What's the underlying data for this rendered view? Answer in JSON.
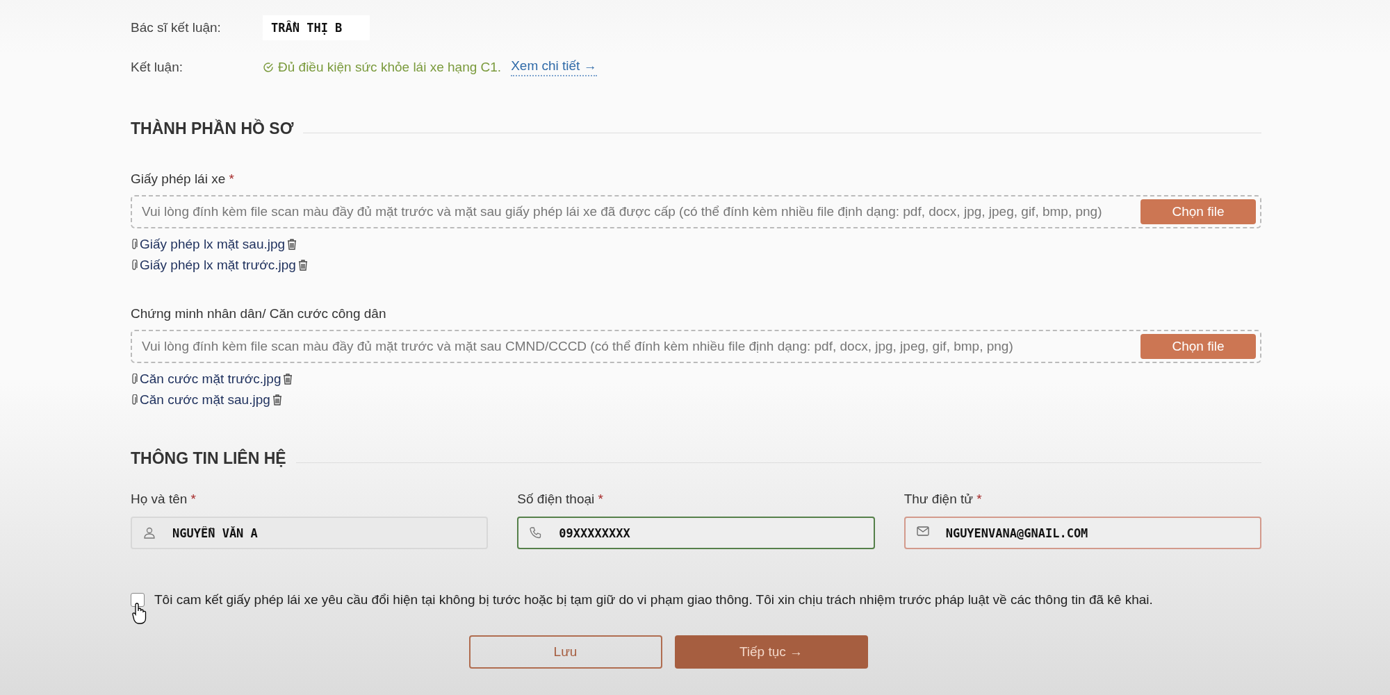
{
  "summary": [
    {
      "kind": "value",
      "label": "Bác sĩ kết luận:",
      "value": "TRẦN THỊ B"
    },
    {
      "kind": "conclusion",
      "label": "Kết luận:",
      "value": "Đủ điều kiện sức khỏe lái xe hạng C1.",
      "link": "Xem chi tiết →"
    }
  ],
  "documents": {
    "title": "THÀNH PHẦN HỒ SƠ",
    "groups": [
      {
        "label": "Giấy phép lái xe",
        "mark": "*",
        "placeholder": "Vui lòng đính kèm file scan màu đầy đủ mặt trước và mặt sau giấy phép lái xe đã được cấp (có thể đính kèm nhiều file định dạng: pdf, docx, jpg, jpeg, gif, bmp, png)",
        "button": "Chọn file",
        "files": [
          "Giấy phép lx mặt sau.jpg",
          "Giấy phép lx mặt trước.jpg"
        ]
      },
      {
        "label": "Chứng minh nhân dân/ Căn cước công dân",
        "placeholder": "Vui lòng đính kèm file scan màu đầy đủ mặt trước và mặt sau CMND/CCCD (có thể đính kèm nhiều file định dạng: pdf, docx, jpg, jpeg, gif, bmp, png)",
        "button": "Chọn file",
        "files": [
          "Căn cước mặt trước.jpg",
          "Căn cước mặt sau.jpg"
        ]
      }
    ]
  },
  "contact": {
    "title": "THÔNG TIN LIÊN HỆ",
    "fields": [
      {
        "kind": "person",
        "label": "Họ và tên",
        "mark": "*",
        "value": "NGUYỄN VĂN A",
        "valid": false,
        "error": false
      },
      {
        "kind": "phone",
        "label": "Số điện thoại",
        "mark": "*",
        "value": "09XXXXXXXX",
        "valid": true,
        "error": false
      },
      {
        "kind": "email",
        "label": "Thư điện tử",
        "mark": "*",
        "value": "NGUYENVANA@GNAIL.COM",
        "valid": false,
        "error": true
      }
    ]
  },
  "agreement": {
    "checked": false,
    "text": "Tôi cam kết giấy phép lái xe yêu cầu đổi hiện tại không bị tước hoặc bị tạm giữ do vi phạm giao thông. Tôi xin chịu trách nhiệm trước pháp luật về các thông tin đã kê khai."
  },
  "buttons": [
    {
      "kind": "secondary",
      "label": "Lưu"
    },
    {
      "kind": "primary",
      "label": "Tiếp tục →"
    }
  ]
}
